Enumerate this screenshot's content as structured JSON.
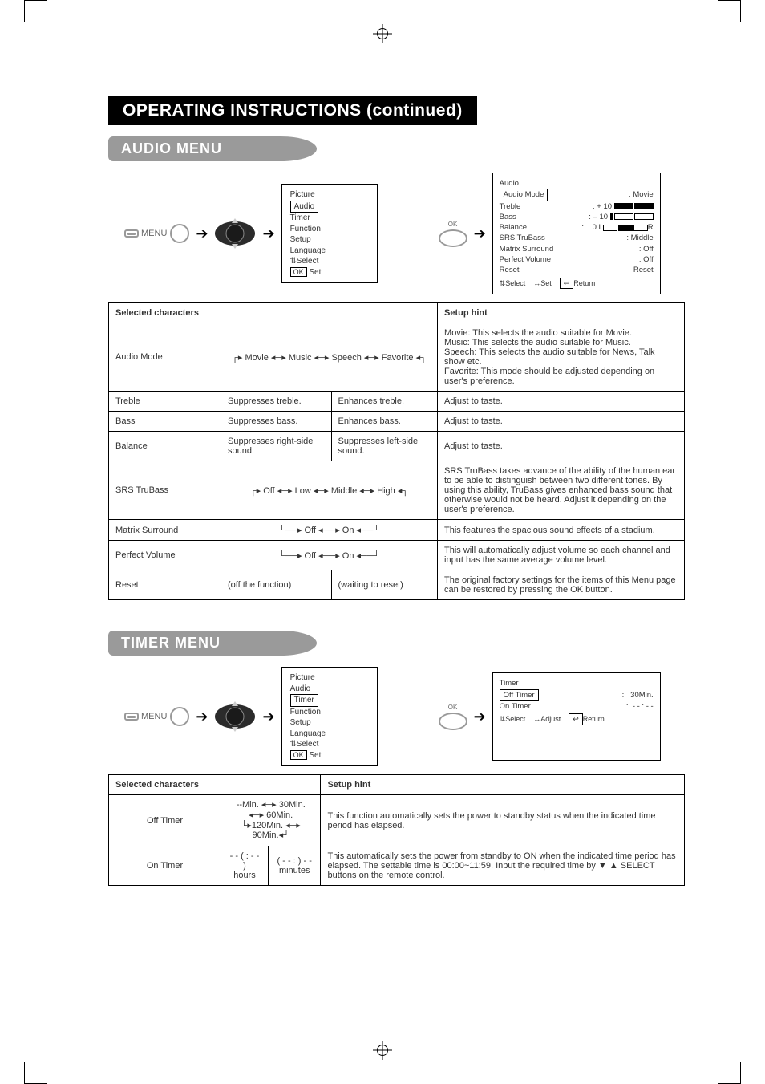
{
  "header": {
    "title": "OPERATING INSTRUCTIONS (continued)"
  },
  "audio": {
    "heading": "AUDIO MENU",
    "menu_label": "MENU",
    "ok_label": "OK",
    "main_menu": {
      "items": [
        "Picture",
        "Audio",
        "Timer",
        "Function",
        "Setup",
        "Language"
      ],
      "highlight_index": 1,
      "foot_select": "Select",
      "foot_set_prefix": "OK",
      "foot_set": "Set"
    },
    "osd": {
      "title": "Audio",
      "rows": [
        {
          "label": "Audio Mode",
          "value": "Movie",
          "highlight": true
        },
        {
          "label": "Treble",
          "value": "+ 10",
          "bar": "full"
        },
        {
          "label": "Bass",
          "value": "– 10",
          "bar": "empty"
        },
        {
          "label": "Balance",
          "value": "0",
          "bar": "balance",
          "left": "L",
          "right": "R"
        },
        {
          "label": "SRS TruBass",
          "value": "Middle"
        },
        {
          "label": "Matrix Surround",
          "value": "Off"
        },
        {
          "label": "Perfect Volume",
          "value": "Off"
        },
        {
          "label": "Reset",
          "value": "Reset"
        }
      ],
      "foot_select": "Select",
      "foot_set": "Set",
      "foot_return": "Return"
    },
    "table": {
      "head": [
        "Selected characters",
        "",
        "",
        "Setup hint"
      ],
      "rows": [
        {
          "label": "Audio Mode",
          "cycle": [
            "Movie",
            "Music",
            "Speech",
            "Favorite"
          ],
          "hint": "Movie: This selects the audio suitable for Movie.\nMusic: This selects the audio suitable for Music.\nSpeech: This selects the audio suitable for News, Talk show etc.\nFavorite: This mode should be adjusted depending on user's preference."
        },
        {
          "label": "Treble",
          "left": "Suppresses treble.",
          "right": "Enhances treble.",
          "hint": "Adjust to taste."
        },
        {
          "label": "Bass",
          "left": "Suppresses bass.",
          "right": "Enhances bass.",
          "hint": "Adjust to taste."
        },
        {
          "label": "Balance",
          "left": "Suppresses right-side sound.",
          "right": "Suppresses left-side sound.",
          "hint": "Adjust to taste."
        },
        {
          "label": "SRS TruBass",
          "cycle": [
            "Off",
            "Low",
            "Middle",
            "High"
          ],
          "hint": "SRS TruBass takes advance of the ability of the human ear to be able to distinguish between two different tones. By using this ability, TruBass gives enhanced bass sound that otherwise would not be heard. Adjust it depending on the user's preference."
        },
        {
          "label": "Matrix Surround",
          "cycle": [
            "Off",
            "On"
          ],
          "hint": "This features the spacious sound effects of a stadium."
        },
        {
          "label": "Perfect Volume",
          "cycle": [
            "Off",
            "On"
          ],
          "hint": "This will automatically adjust volume so each channel and input has the same average volume level."
        },
        {
          "label": "Reset",
          "left": "(off the function)",
          "right": "(waiting to reset)",
          "hint": "The original factory settings for the items of this Menu page can be restored by pressing the OK button."
        }
      ]
    }
  },
  "timer": {
    "heading": "TIMER MENU",
    "main_menu": {
      "items": [
        "Picture",
        "Audio",
        "Timer",
        "Function",
        "Setup",
        "Language"
      ],
      "highlight_index": 2,
      "foot_select": "Select",
      "foot_set_prefix": "OK",
      "foot_set": "Set"
    },
    "osd": {
      "title": "Timer",
      "rows": [
        {
          "label": "Off Timer",
          "value": "30Min.",
          "highlight": true
        },
        {
          "label": "On Timer",
          "value": "- - : - -"
        }
      ],
      "foot_select": "Select",
      "foot_adjust": "Adjust",
      "foot_return": "Return"
    },
    "table": {
      "head": [
        "Selected characters",
        "",
        "",
        "Setup hint"
      ],
      "rows": [
        {
          "label": "Off Timer",
          "cycle_top": [
            "--Min.",
            "30Min.",
            "60Min."
          ],
          "cycle_bot": [
            "120Min.",
            "90Min."
          ],
          "hint": "This function automatically sets the power to standby status when the indicated time period has elapsed."
        },
        {
          "label": "On Timer",
          "left": "- - ( : - - )\nhours",
          "right": "( - -  : ) - -\nminutes",
          "hint": "This automatically sets the power from standby to ON when the indicated time period has elapsed. The settable time is 00:00~11:59. Input the required time by ▼ ▲ SELECT buttons on the remote control."
        }
      ]
    }
  }
}
